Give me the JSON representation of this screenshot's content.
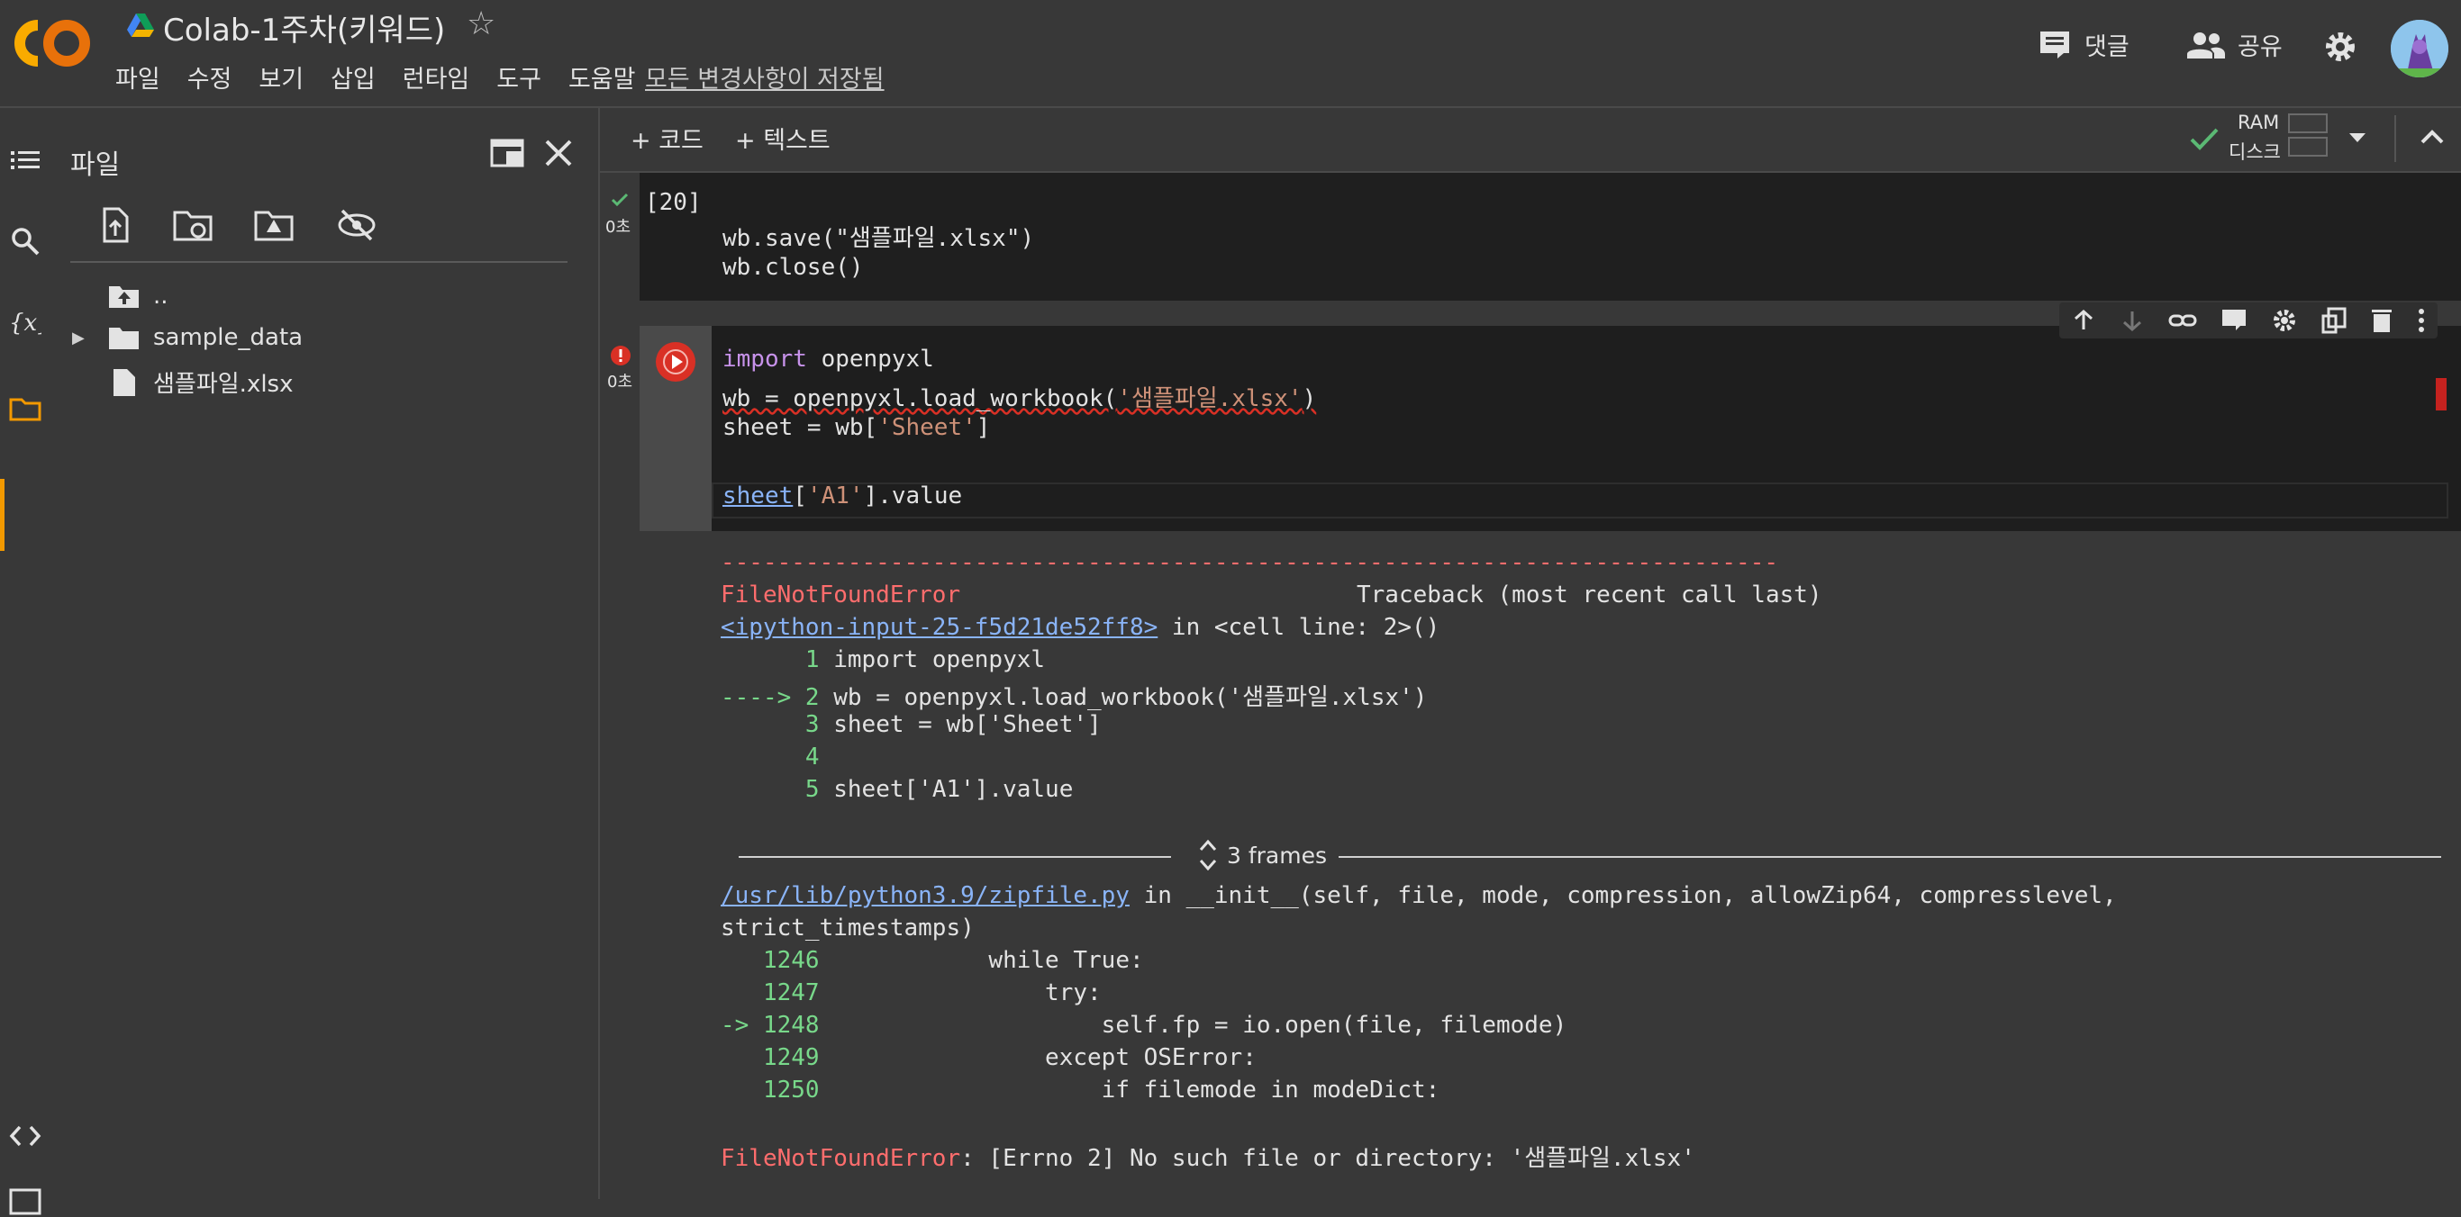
{
  "header": {
    "logo_text": "CO",
    "doc_title": "Colab-1주차(키워드)",
    "menu": [
      "파일",
      "수정",
      "보기",
      "삽입",
      "런타임",
      "도구",
      "도움말"
    ],
    "save_status": "모든 변경사항이 저장됨",
    "comment_label": "댓글",
    "share_label": "공유"
  },
  "files_panel": {
    "title": "파일",
    "tree": [
      {
        "label": "..",
        "icon": "folder-up-icon"
      },
      {
        "label": "sample_data",
        "icon": "folder-icon"
      },
      {
        "label": "샘플파일.xlsx",
        "icon": "file-icon"
      }
    ]
  },
  "notebook": {
    "add_code": "+ 코드",
    "add_text": "+ 텍스트",
    "ram_label": "RAM",
    "disk_label": "디스크",
    "cell1": {
      "exec_count": "[20]",
      "time": "0초",
      "lines": [
        "wb.save(\"샘플파일.xlsx\")",
        "wb.close()"
      ]
    },
    "cell2": {
      "time": "0초",
      "line1_kw": "import",
      "line1_rest": " openpyxl",
      "line2_a": "wb = openpyxl.load_workbook(",
      "line2_str": "'샘플파일.xlsx'",
      "line2_b": ")",
      "line3_a": "sheet = wb[",
      "line3_str": "'Sheet'",
      "line3_b": "]",
      "line5_var": "sheet",
      "line5_a": "[",
      "line5_str": "'A1'",
      "line5_b": "].value"
    },
    "output": {
      "dashes": "---------------------------------------------------------------------------",
      "error_name": "FileNotFoundError",
      "traceback_label": "Traceback (most recent call last)",
      "input_link": "<ipython-input-25-f5d21de52ff8>",
      "in_cell": " in <cell line: 2>()",
      "frames_label": "3 frames",
      "trace_lines": [
        {
          "arrow": "     ",
          "num": " 1",
          "code": "import openpyxl"
        },
        {
          "arrow": "----> ",
          "num": "2",
          "code": "wb = openpyxl.load_workbook('샘플파일.xlsx')"
        },
        {
          "arrow": "     ",
          "num": " 3",
          "code": "sheet = wb['Sheet']"
        },
        {
          "arrow": "     ",
          "num": " 4",
          "code": ""
        },
        {
          "arrow": "     ",
          "num": " 5",
          "code": "sheet['A1'].value"
        }
      ],
      "zip_link": "/usr/lib/python3.9/zipfile.py",
      "zip_sig": " in __init__(self, file, mode, compression, allowZip64, compresslevel,",
      "zip_sig2": "strict_timestamps)",
      "zip_lines": [
        {
          "arrow": "   ",
          "num": "1246",
          "code": "            while True:"
        },
        {
          "arrow": "   ",
          "num": "1247",
          "code": "                try:"
        },
        {
          "arrow": "-> ",
          "num": "1248",
          "code": "                    self.fp = io.open(file, filemode)"
        },
        {
          "arrow": "   ",
          "num": "1249",
          "code": "                except OSError:"
        },
        {
          "arrow": "   ",
          "num": "1250",
          "code": "                    if filemode in modeDict:"
        }
      ],
      "final_error_name": "FileNotFoundError",
      "final_error_msg": ": [Errno 2] No such file or directory: '샘플파일.xlsx'"
    }
  },
  "colors": {
    "accent": "#f29900",
    "error": "#ff6d6d",
    "link": "#8ab4f8"
  }
}
